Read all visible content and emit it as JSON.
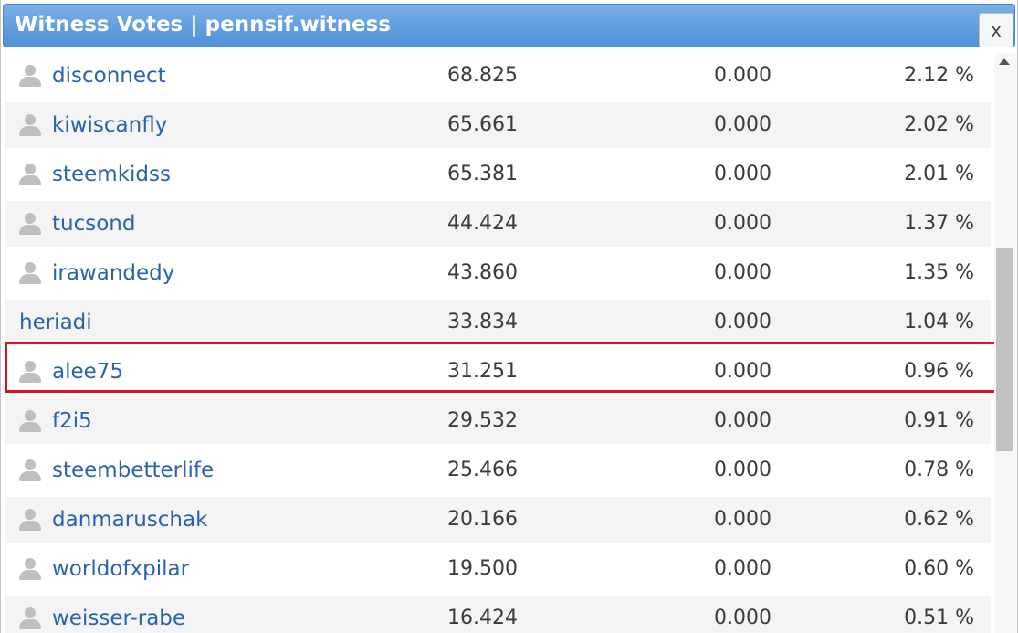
{
  "dialog": {
    "title": "Witness Votes | pennsif.witness",
    "close_label": "x"
  },
  "votes": [
    {
      "account": "disconnect",
      "v1": "68.825",
      "v2": "0.000",
      "pct": "2.12 %",
      "icon": "user-icon"
    },
    {
      "account": "kiwiscanfly",
      "v1": "65.661",
      "v2": "0.000",
      "pct": "2.02 %",
      "icon": "user-icon"
    },
    {
      "account": "steemkidss",
      "v1": "65.381",
      "v2": "0.000",
      "pct": "2.01 %",
      "icon": "user-icon"
    },
    {
      "account": "tucsond",
      "v1": "44.424",
      "v2": "0.000",
      "pct": "1.37 %",
      "icon": "user-icon"
    },
    {
      "account": "irawandedy",
      "v1": "43.860",
      "v2": "0.000",
      "pct": "1.35 %",
      "icon": "user-icon"
    },
    {
      "account": "heriadi",
      "v1": "33.834",
      "v2": "0.000",
      "pct": "1.04 %",
      "icon": null
    },
    {
      "account": "alee75",
      "v1": "31.251",
      "v2": "0.000",
      "pct": "0.96 %",
      "icon": "user-icon",
      "highlighted": true
    },
    {
      "account": "f2i5",
      "v1": "29.532",
      "v2": "0.000",
      "pct": "0.91 %",
      "icon": "user-icon"
    },
    {
      "account": "steembetterlife",
      "v1": "25.466",
      "v2": "0.000",
      "pct": "0.78 %",
      "icon": "user-icon"
    },
    {
      "account": "danmaruschak",
      "v1": "20.166",
      "v2": "0.000",
      "pct": "0.62 %",
      "icon": "user-icon"
    },
    {
      "account": "worldofxpilar",
      "v1": "19.500",
      "v2": "0.000",
      "pct": "0.60 %",
      "icon": "user-icon"
    },
    {
      "account": "weisser-rabe",
      "v1": "16.424",
      "v2": "0.000",
      "pct": "0.51 %",
      "icon": "user-icon"
    }
  ],
  "colors": {
    "titlebar": "#5b9be0",
    "link": "#2a62ad",
    "highlight_border": "#d9141e"
  }
}
